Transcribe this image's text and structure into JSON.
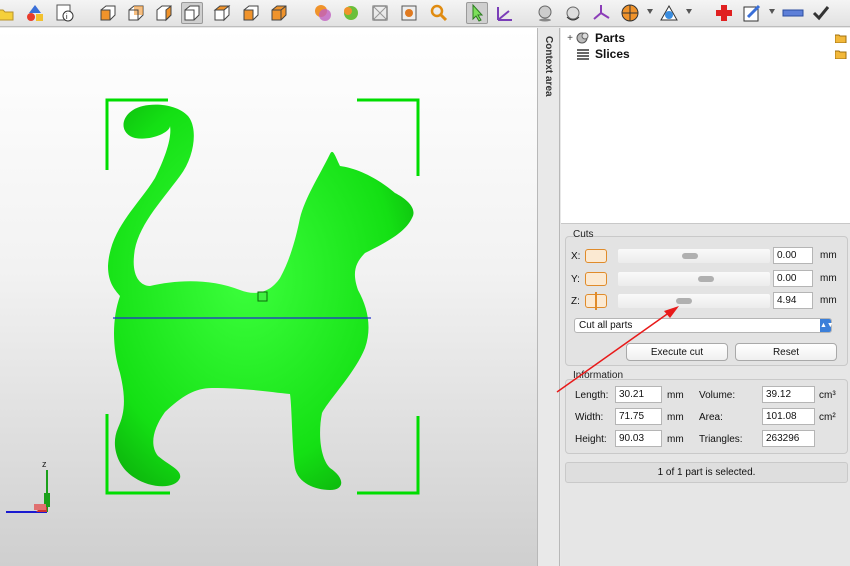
{
  "toolbar": {
    "icons": [
      "open-file-icon",
      "add-shapes-icon",
      "measure-icon",
      "view-front-icon",
      "view-back-icon",
      "view-left-icon",
      "view-right-icon",
      "view-top-icon",
      "view-bottom-icon",
      "shading-icon",
      "texture-icon",
      "wireframe-icon",
      "points-icon",
      "zoom-icon",
      "select-icon",
      "move-icon",
      "sphere-icon",
      "rotate-icon",
      "axes-icon",
      "color-icon",
      "support-icon",
      "add-icon",
      "slice-icon",
      "ruler-icon",
      "check-icon"
    ],
    "accent_orange": "#f0932b",
    "accent_red": "#e02020"
  },
  "viewport": {
    "model_color": "#18e818",
    "bbox_color": "#00dd00",
    "cut_line_color": "#1f2fd0",
    "axis_label_z": "z",
    "annotation_arrow_color": "#e81a1a"
  },
  "context_tab": {
    "label": "Context area"
  },
  "tree": {
    "items": [
      {
        "label": "Parts",
        "icon": "parts-icon",
        "twisty": "+"
      },
      {
        "label": "Slices",
        "icon": "slices-icon",
        "twisty": ""
      }
    ]
  },
  "cuts": {
    "title": "Cuts",
    "rows": [
      {
        "axis": "X:",
        "value": "0.00",
        "unit": "mm",
        "slider_pos": 0.47
      },
      {
        "axis": "Y:",
        "value": "0.00",
        "unit": "mm",
        "slider_pos": 0.59
      },
      {
        "axis": "Z:",
        "value": "4.94",
        "unit": "mm",
        "slider_pos": 0.43
      }
    ],
    "mode_select": "Cut all parts",
    "execute_label": "Execute cut",
    "reset_label": "Reset"
  },
  "information": {
    "title": "Information",
    "length_label": "Length:",
    "length_value": "30.21",
    "length_unit": "mm",
    "width_label": "Width:",
    "width_value": "71.75",
    "width_unit": "mm",
    "height_label": "Height:",
    "height_value": "90.03",
    "height_unit": "mm",
    "volume_label": "Volume:",
    "volume_value": "39.12",
    "volume_unit": "cm³",
    "area_label": "Area:",
    "area_value": "101.08",
    "area_unit": "cm²",
    "triangles_label": "Triangles:",
    "triangles_value": "263296"
  },
  "status": {
    "text": "1 of 1 part is selected."
  }
}
